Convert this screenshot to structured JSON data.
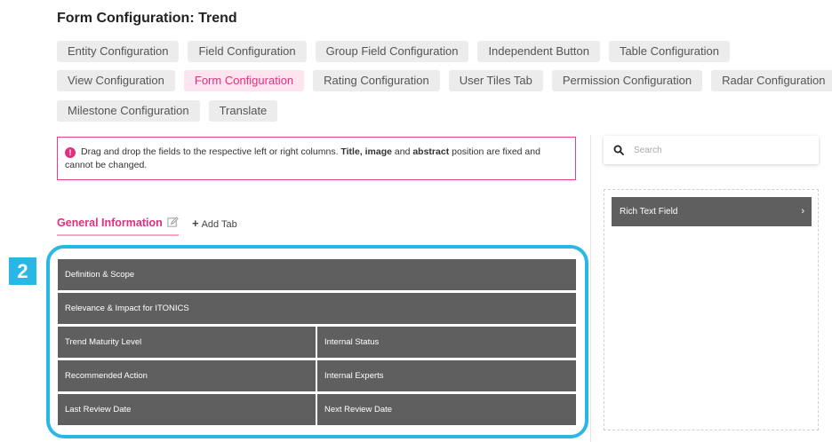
{
  "page_title": "Form Configuration: Trend",
  "config_tabs": {
    "entity": "Entity Configuration",
    "field": "Field Configuration",
    "group_field": "Group Field Configuration",
    "independent_button": "Independent Button",
    "table": "Table Configuration",
    "view": "View Configuration",
    "form": "Form Configuration",
    "rating": "Rating Configuration",
    "user_tiles": "User Tiles Tab",
    "permission": "Permission Configuration",
    "radar": "Radar Configuration",
    "milestone": "Milestone Configuration",
    "translate": "Translate",
    "active": "Form Configuration"
  },
  "info": {
    "icon": "exclamation-icon",
    "text_1": "Drag and drop the fields to the respective left or right columns. ",
    "bold_1": "Title, image",
    "text_2": " and ",
    "bold_2": "abstract",
    "text_3": " position are fixed and cannot be changed."
  },
  "form_tabs": {
    "general_information": "General Information",
    "add_tab": "Add Tab"
  },
  "annotation_badge": "2",
  "fields": {
    "definition_scope": "Definition & Scope",
    "relevance_impact": "Relevance & Impact for ITONICS",
    "trend_maturity_level": "Trend Maturity Level",
    "internal_status": "Internal Status",
    "recommended_action": "Recommended Action",
    "internal_experts": "Internal Experts",
    "last_review_date": "Last Review Date",
    "next_review_date": "Next Review Date"
  },
  "sidebar": {
    "search_placeholder": "Search",
    "search_value": "",
    "available_fields": [
      "Rich Text Field"
    ]
  },
  "colors": {
    "accent": "#e0307f",
    "active_tab_bg": "#fde4ef",
    "field_bg": "#5f5f5f",
    "highlight": "#29b8e6"
  }
}
